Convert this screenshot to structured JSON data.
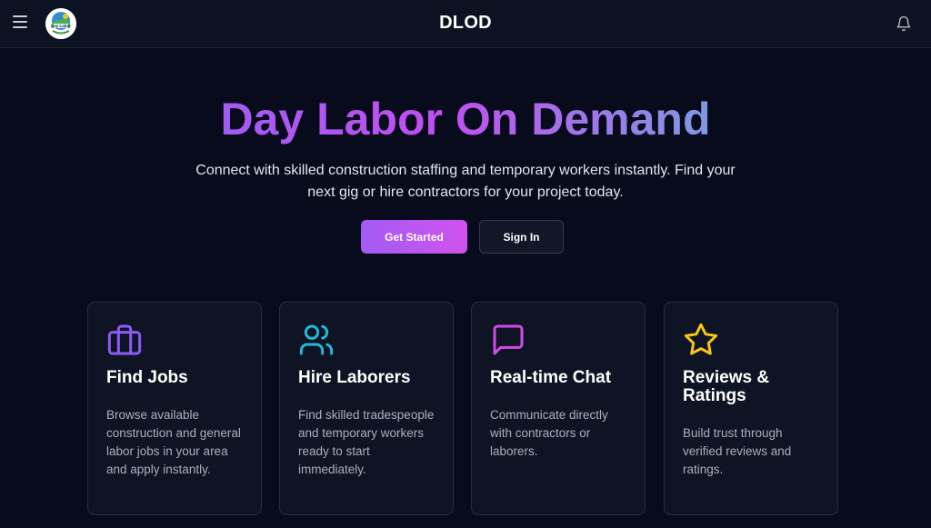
{
  "header": {
    "app_title": "DLOD",
    "logo_text": "Day Labor"
  },
  "hero": {
    "title": "Day Labor On Demand",
    "subtitle": "Connect with skilled construction staffing and temporary workers instantly. Find your next gig or hire contractors for your project today.",
    "get_started_label": "Get Started",
    "sign_in_label": "Sign In"
  },
  "features": [
    {
      "icon": "briefcase-icon",
      "color": "#8b5cf6",
      "title": "Find Jobs",
      "description": "Browse available construction and general labor jobs in your area and apply instantly."
    },
    {
      "icon": "users-icon",
      "color": "#22b8d6",
      "title": "Hire Laborers",
      "description": "Find skilled tradespeople and temporary workers ready to start immediately."
    },
    {
      "icon": "message-square-icon",
      "color": "#d24ae8",
      "title": "Real-time Chat",
      "description": "Communicate directly with contractors or laborers."
    },
    {
      "icon": "star-icon",
      "color": "#f5c518",
      "title": "Reviews & Ratings",
      "description": "Build trust through verified reviews and ratings."
    }
  ],
  "colors": {
    "background": "#070b1c",
    "header_bg": "#0d1222",
    "accent_start": "#a35bf5",
    "accent_end": "#d053ec"
  }
}
